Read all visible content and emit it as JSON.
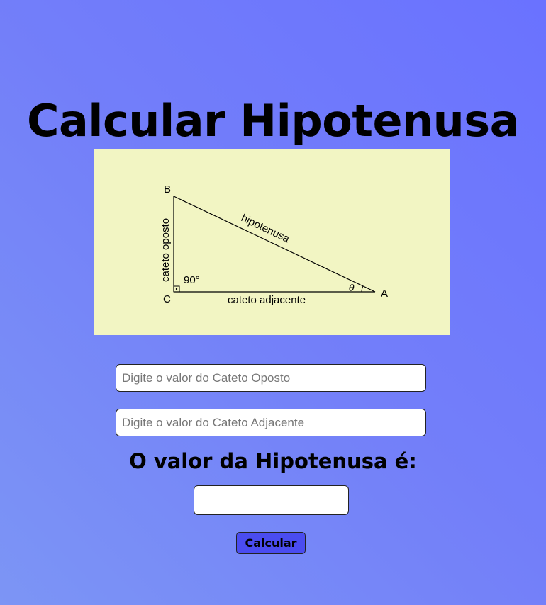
{
  "page": {
    "title": "Calcular Hipotenusa"
  },
  "diagram": {
    "vertex_b": "B",
    "vertex_c": "C",
    "vertex_a": "A",
    "hypotenuse_label": "hipotenusa",
    "opposite_label": "cateto oposto",
    "adjacent_label": "cateto adjacente",
    "right_angle_label": "90°",
    "angle_label": "θ",
    "background_color": "#f2f5c3"
  },
  "form": {
    "opposite_placeholder": "Digite o valor do Cateto Oposto",
    "adjacent_placeholder": "Digite o valor do Cateto Adjacente",
    "result_label": "O valor da Hipotenusa é:",
    "result_value": "",
    "calculate_label": "Calcular"
  },
  "colors": {
    "button": "#4a4cf0",
    "gradient_start": "#6a72ff",
    "gradient_end": "#7c95f5"
  }
}
